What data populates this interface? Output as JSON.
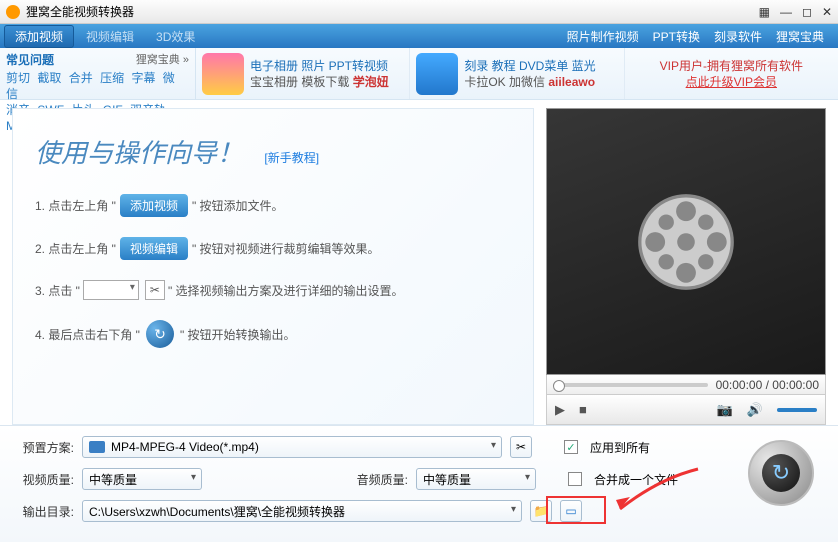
{
  "title": "狸窝全能视频转换器",
  "toolbar": {
    "add": "添加视频",
    "edit": "视频编辑",
    "fx": "3D效果",
    "r": [
      "照片制作视频",
      "PPT转换",
      "刻录软件",
      "狸窝宝典"
    ]
  },
  "faq": {
    "hdr": "常见问题",
    "sub": "狸窝宝典 »",
    "links": [
      "剪切",
      "截取",
      "合并",
      "压缩",
      "字幕",
      "微信",
      "消音",
      "SWF",
      "片头",
      "GIF",
      "双音轨",
      "MV"
    ]
  },
  "promos": [
    {
      "l1": "电子相册 照片 PPT转视频",
      "l2": "宝宝相册 模板下载",
      "l2b": "学泡妞"
    },
    {
      "l1": "刻录 教程 DVD菜单 蓝光",
      "l2": "卡拉OK 加微信",
      "l2b": "aiileawo"
    },
    {
      "l1": "VIP用户-拥有狸窝所有软件",
      "l2": "点此升级VIP会员"
    }
  ],
  "wizard": {
    "title": "使用与操作向导！",
    "newbie": "[新手教程]",
    "s1a": "1. 点击左上角 \"",
    "s1btn": "添加视频",
    "s1b": "\" 按钮添加文件。",
    "s2a": "2. 点击左上角 \"",
    "s2btn": "视频编辑",
    "s2b": "\" 按钮对视频进行裁剪编辑等效果。",
    "s3a": "3. 点击 \"",
    "s3b": "\" 选择视频输出方案及进行详细的输出设置。",
    "s4a": "4. 最后点击右下角 \"",
    "s4b": "\" 按钮开始转换输出。"
  },
  "player": {
    "time": "00:00:00 / 00:00:00"
  },
  "bottom": {
    "profile_lbl": "预置方案:",
    "profile": "MP4-MPEG-4 Video(*.mp4)",
    "apply": "应用到所有",
    "vq_lbl": "视频质量:",
    "vq": "中等质量",
    "aq_lbl": "音频质量:",
    "aq": "中等质量",
    "merge": "合并成一个文件",
    "out_lbl": "输出目录:",
    "out": "C:\\Users\\xzwh\\Documents\\狸窝\\全能视频转换器"
  }
}
